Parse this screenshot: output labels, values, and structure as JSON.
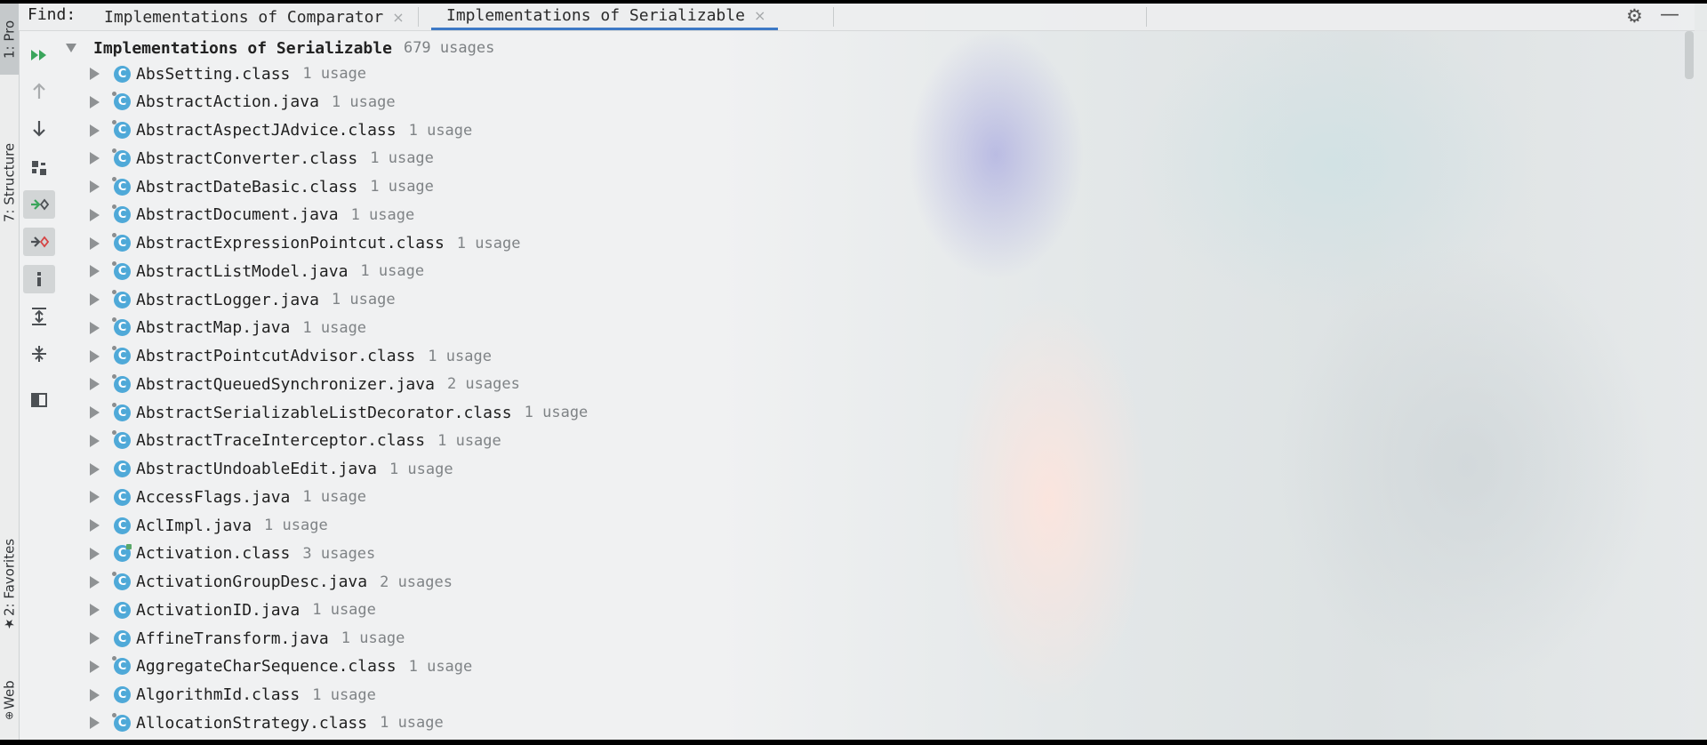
{
  "header": {
    "find_label": "Find:",
    "tabs": [
      {
        "label": "Implementations of Comparator",
        "active": false
      },
      {
        "label": "Implementations of Serializable",
        "active": true
      }
    ],
    "close_glyph": "×"
  },
  "side_strip": {
    "project_label": "1: Pro",
    "structure_label": "7: Structure",
    "favorites_label": "2: Favorites",
    "web_label": "Web"
  },
  "toolbar_icons": [
    "rerun-icon",
    "previous-occurrence-icon",
    "next-occurrence-icon",
    "group-by-module-icon",
    "navigate-to-source-icon",
    "autoscroll-from-source-icon",
    "info-icon",
    "expand-all-icon",
    "collapse-all-icon",
    "preview-icon"
  ],
  "tree": {
    "root_title": "Implementations of Serializable",
    "root_count": "679 usages",
    "items": [
      {
        "name": "AbsSetting.class",
        "usage": "1 usage",
        "icon": "class-icon"
      },
      {
        "name": "AbstractAction.java",
        "usage": "1 usage",
        "icon": "abstract-class-icon"
      },
      {
        "name": "AbstractAspectJAdvice.class",
        "usage": "1 usage",
        "icon": "abstract-class-icon"
      },
      {
        "name": "AbstractConverter.class",
        "usage": "1 usage",
        "icon": "abstract-class-icon"
      },
      {
        "name": "AbstractDateBasic.class",
        "usage": "1 usage",
        "icon": "abstract-class-icon"
      },
      {
        "name": "AbstractDocument.java",
        "usage": "1 usage",
        "icon": "abstract-class-icon"
      },
      {
        "name": "AbstractExpressionPointcut.class",
        "usage": "1 usage",
        "icon": "abstract-class-icon"
      },
      {
        "name": "AbstractListModel.java",
        "usage": "1 usage",
        "icon": "abstract-class-icon"
      },
      {
        "name": "AbstractLogger.java",
        "usage": "1 usage",
        "icon": "abstract-class-icon"
      },
      {
        "name": "AbstractMap.java",
        "usage": "1 usage",
        "icon": "abstract-class-icon"
      },
      {
        "name": "AbstractPointcutAdvisor.class",
        "usage": "1 usage",
        "icon": "abstract-class-icon"
      },
      {
        "name": "AbstractQueuedSynchronizer.java",
        "usage": "2 usages",
        "icon": "abstract-class-icon"
      },
      {
        "name": "AbstractSerializableListDecorator.class",
        "usage": "1 usage",
        "icon": "abstract-class-icon"
      },
      {
        "name": "AbstractTraceInterceptor.class",
        "usage": "1 usage",
        "icon": "abstract-class-icon"
      },
      {
        "name": "AbstractUndoableEdit.java",
        "usage": "1 usage",
        "icon": "class-icon"
      },
      {
        "name": "AccessFlags.java",
        "usage": "1 usage",
        "icon": "class-icon"
      },
      {
        "name": "AclImpl.java",
        "usage": "1 usage",
        "icon": "class-icon"
      },
      {
        "name": "Activation.class",
        "usage": "3 usages",
        "icon": "modified-class-icon"
      },
      {
        "name": "ActivationGroupDesc.java",
        "usage": "2 usages",
        "icon": "abstract-class-icon"
      },
      {
        "name": "ActivationID.java",
        "usage": "1 usage",
        "icon": "class-icon"
      },
      {
        "name": "AffineTransform.java",
        "usage": "1 usage",
        "icon": "class-icon"
      },
      {
        "name": "AggregateCharSequence.class",
        "usage": "1 usage",
        "icon": "abstract-class-icon"
      },
      {
        "name": "AlgorithmId.class",
        "usage": "1 usage",
        "icon": "class-icon"
      },
      {
        "name": "AllocationStrategy.class",
        "usage": "1 usage",
        "icon": "abstract-class-icon"
      }
    ]
  },
  "class_glyph": "C",
  "colors": {
    "accent": "#3d79c6",
    "class_icon": "#4fa9d8",
    "usage_text": "#7f8386"
  }
}
